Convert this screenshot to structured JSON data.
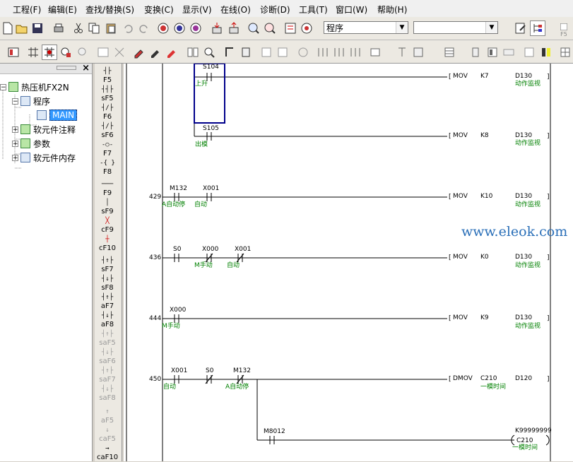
{
  "menu": [
    "工程(F)",
    "编辑(E)",
    "查找/替换(S)",
    "变换(C)",
    "显示(V)",
    "在线(O)",
    "诊断(D)",
    "工具(T)",
    "窗口(W)",
    "帮助(H)"
  ],
  "toolbar": {
    "program_combo": "程序",
    "device_combo": "",
    "f5_label": "F5"
  },
  "tree": {
    "close": "×",
    "root": "热压机FX2N",
    "program": "程序",
    "main": "MAIN",
    "device_comment": "软元件注释",
    "params": "参数",
    "device_memory": "软元件内存"
  },
  "palette": [
    {
      "sym": "┤├",
      "key": "F5"
    },
    {
      "sym": "┤┤├",
      "key": "sF5"
    },
    {
      "sym": "┤/├",
      "key": "F6"
    },
    {
      "sym": "┤/├",
      "key": "sF6"
    },
    {
      "sym": "-○-",
      "key": "F7"
    },
    {
      "sym": "-{ }",
      "key": "F8"
    },
    {
      "sym": "───",
      "key": "F9"
    },
    {
      "sym": "│",
      "key": "sF9"
    },
    {
      "sym": "╳",
      "key": "cF9"
    },
    {
      "sym": "┼",
      "key": "cF10"
    },
    {
      "sym": "┤↑├",
      "key": "sF7"
    },
    {
      "sym": "┤↓├",
      "key": "sF8"
    },
    {
      "sym": "┤↑├",
      "key": "aF7"
    },
    {
      "sym": "┤↓├",
      "key": "aF8"
    },
    {
      "sym": "┤↑├",
      "key": "saF5"
    },
    {
      "sym": "┤↓├",
      "key": "saF6"
    },
    {
      "sym": "┤↑├",
      "key": "saF7"
    },
    {
      "sym": "┤↓├",
      "key": "saF8"
    },
    {
      "sym": "↑",
      "key": "aF5"
    },
    {
      "sym": "↓",
      "key": "caF5"
    },
    {
      "sym": "→",
      "key": "caF10"
    }
  ],
  "ladder": {
    "r0": {
      "contact": "S104",
      "comment": "上升",
      "op": "MOV",
      "src": "K7",
      "dst": "D130",
      "dst_comment": "动作监视"
    },
    "r1": {
      "contact": "S105",
      "comment": "出模",
      "op": "MOV",
      "src": "K8",
      "dst": "D130",
      "dst_comment": "动作监视"
    },
    "r2": {
      "step": "429",
      "c1": "M132",
      "c1_comment": "A自动停",
      "c2": "X001",
      "c2_comment": "自动",
      "op": "MOV",
      "src": "K10",
      "dst": "D130",
      "dst_comment": "动作监视"
    },
    "r3": {
      "step": "436",
      "c1": "S0",
      "c2": "X000",
      "c2_comment": "M手动",
      "c3": "X001",
      "c3_comment": "自动",
      "op": "MOV",
      "src": "K0",
      "dst": "D130",
      "dst_comment": "动作监视"
    },
    "r4": {
      "step": "444",
      "c1": "X000",
      "c1_comment": "M手动",
      "op": "MOV",
      "src": "K9",
      "dst": "D130",
      "dst_comment": "动作监视"
    },
    "r5": {
      "step": "450",
      "c1": "X001",
      "c1_comment": "自动",
      "c2": "S0",
      "c3": "M132",
      "c3_comment": "A自动停",
      "op": "DMOV",
      "src": "C210",
      "src_comment": "一模时间",
      "dst": "D120"
    },
    "r6": {
      "c1": "M8012",
      "coil_const": "K99999999",
      "coil": "C210",
      "coil_comment": "一模时间"
    },
    "bracket_l": "[",
    "bracket_r": "]"
  },
  "watermark": "www.eleok.com"
}
